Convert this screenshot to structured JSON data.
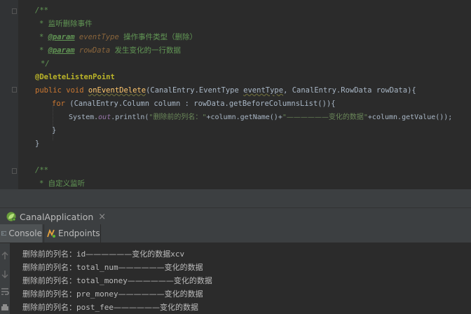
{
  "editor": {
    "lines": [
      {
        "text": "/**"
      },
      {
        "bullet": "* ",
        "text": "监听删除事件"
      },
      {
        "bullet": "* ",
        "tag": "@param",
        "param": "eventType",
        "text": "操作事件类型（删除）"
      },
      {
        "bullet": "* ",
        "tag": "@param",
        "param": "rowData",
        "text": "发生变化的一行数据"
      },
      {
        "text": "*/"
      },
      {
        "annotation": "@DeleteListenPoint"
      },
      {
        "kw1": "public",
        "kw2": "void",
        "method": "onEventDelete",
        "p1type": "(CanalEntry.EventType ",
        "p1name": "eventType",
        "rest": ", CanalEntry.RowData rowData){"
      },
      {
        "kw": "for",
        "rest": " (CanalEntry.Column column : rowData.getBeforeColumnsList()){"
      },
      {
        "prefix": "System.",
        "field": "out",
        "call": ".println(",
        "s1q": "\"",
        "s1": "删除前的列名：",
        "s1e": "\"",
        "mid": "+column.getName()+",
        "s2q": "\"",
        "s2": "——————变化的数据",
        "s2e": "\"",
        "end": "+column.getValue());"
      },
      {
        "text": "}"
      },
      {
        "text": "}"
      },
      {
        "text": ""
      },
      {
        "text": "/**"
      },
      {
        "bullet": "* ",
        "text": "自定义监听"
      }
    ]
  },
  "run_panel": {
    "app_name": "CanalApplication",
    "close_glyph": "×",
    "tabs": [
      {
        "label": "Console"
      },
      {
        "label": "Endpoints"
      }
    ]
  },
  "console": {
    "lines": [
      {
        "label": "删除前的列名：",
        "col": "id",
        "dash": "——————",
        "tail": "变化的数据",
        "value": "xcv"
      },
      {
        "label": "删除前的列名：",
        "col": "total_num",
        "dash": "——————",
        "tail": "变化的数据",
        "value": ""
      },
      {
        "label": "删除前的列名：",
        "col": "total_money",
        "dash": "——————",
        "tail": "变化的数据",
        "value": ""
      },
      {
        "label": "删除前的列名：",
        "col": "pre_money",
        "dash": "——————",
        "tail": "变化的数据",
        "value": ""
      },
      {
        "label": "删除前的列名：",
        "col": "post_fee",
        "dash": "——————",
        "tail": "变化的数据",
        "value": ""
      }
    ]
  },
  "icons": {
    "run_app": "spring-leaf-icon",
    "console_tab": "console-icon",
    "endpoints_tab": "endpoints-icon",
    "side": [
      "arrow-up-icon",
      "arrow-down-icon",
      "soft-wrap-icon",
      "print-icon"
    ]
  }
}
